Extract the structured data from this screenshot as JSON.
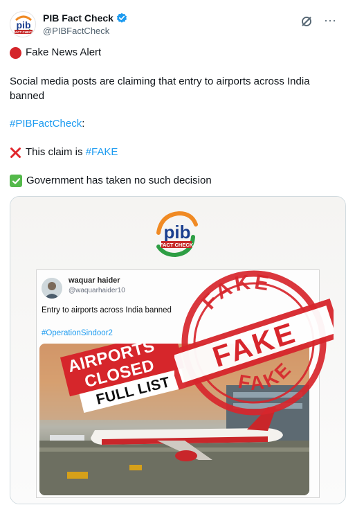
{
  "author": {
    "display_name": "PIB Fact Check",
    "handle": "@PIBFactCheck",
    "avatar_text": "pib",
    "avatar_subtext": "FACT CHECK"
  },
  "post": {
    "alert_label": "Fake News Alert",
    "claim_text": "Social media posts are claiming that entry to airports across India banned",
    "hashtag_line": "#PIBFactCheck",
    "hashtag_suffix": ":",
    "fake_prefix": "This claim is ",
    "fake_hashtag": "#FAKE",
    "truth_text": "Government has taken no such decision"
  },
  "media": {
    "logo_text": "pib",
    "logo_subtext": "FACT CHECK",
    "embedded_post": {
      "name": "waquar haider",
      "handle": "@waquarhaider10",
      "text": "Entry to airports across India banned",
      "hashtag": "#OperationSindoor2",
      "banner_line1": "AIRPORTS",
      "banner_line2": "CLOSED",
      "banner_line3": "FULL LIST"
    },
    "stamp_top": "FAKE",
    "stamp_center": "FAKE",
    "stamp_bottom": "FAKE"
  },
  "colors": {
    "link": "#1d9bf0",
    "stamp_red": "#d7262c",
    "verified_blue": "#1d9bf0",
    "alert_red": "#d4252a",
    "check_green": "#54b94b"
  },
  "icons": [
    "verified-badge-icon",
    "grok-icon",
    "more-icon",
    "red-circle-icon",
    "cross-mark-icon",
    "check-mark-icon"
  ]
}
